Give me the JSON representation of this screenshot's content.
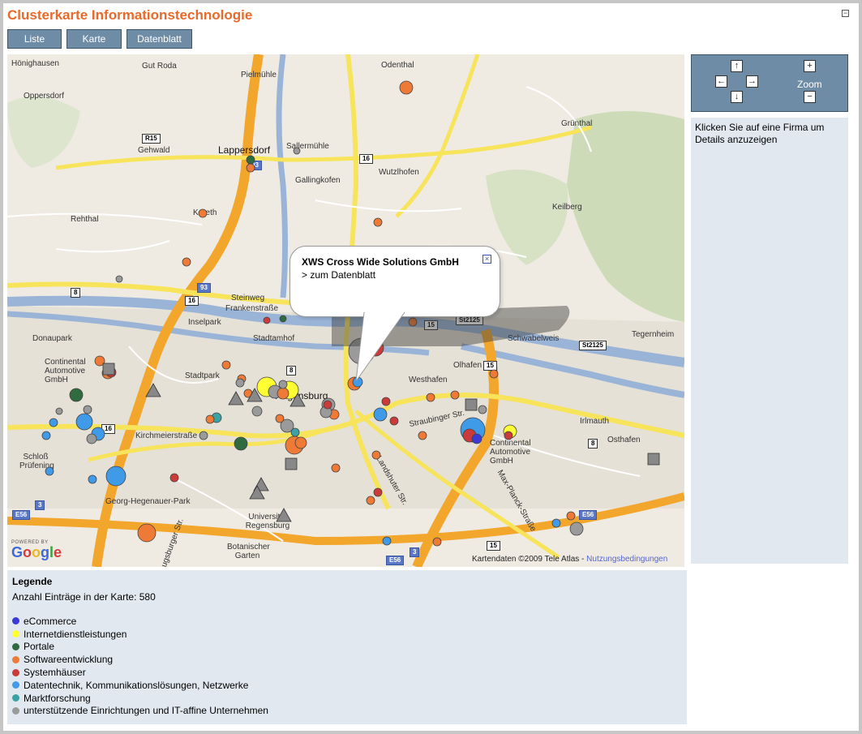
{
  "header": {
    "title": "Clusterkarte Informationstechnologie",
    "collapse_symbol": "−"
  },
  "tabs": [
    {
      "label": "Liste"
    },
    {
      "label": "Karte"
    },
    {
      "label": "Datenblatt"
    }
  ],
  "controls": {
    "up": "↑",
    "down": "↓",
    "left": "←",
    "right": "→",
    "zoom_in": "+",
    "zoom_out": "−",
    "zoom_label": "Zoom"
  },
  "info_panel": {
    "text": "Klicken Sie auf eine Firma um Details anzuzeigen"
  },
  "popup": {
    "company": "XWS Cross Wide Solutions GmbH",
    "link": "> zum Datenblatt",
    "close_symbol": "×"
  },
  "map": {
    "copyright": "Kartendaten ©2009 Tele Atlas -",
    "terms_link": "Nutzungsbedingungen",
    "powered_by": "POWERED BY",
    "logo": "Google",
    "places": [
      {
        "text": "Hönighausen"
      },
      {
        "text": "Gut Roda"
      },
      {
        "text": "Pielmühle"
      },
      {
        "text": "Odenthal"
      },
      {
        "text": "Oppersdorf"
      },
      {
        "text": "Gehwald"
      },
      {
        "text": "Lappersdorf"
      },
      {
        "text": "Sallermühle"
      },
      {
        "text": "Grünthal"
      },
      {
        "text": "Gallingkofen"
      },
      {
        "text": "Wutzlhofen"
      },
      {
        "text": "Rehthal"
      },
      {
        "text": "Kareth"
      },
      {
        "text": "Keilberg"
      },
      {
        "text": "Steinweg"
      },
      {
        "text": "Inselpark"
      },
      {
        "text": "Stadtamhof"
      },
      {
        "text": "Donaupark"
      },
      {
        "text": "Continental Automotive GmbH"
      },
      {
        "text": "Stadtpark"
      },
      {
        "text": "Westhafen"
      },
      {
        "text": "Olhafen"
      },
      {
        "text": "Schwabelweis"
      },
      {
        "text": "Tegernheim"
      },
      {
        "text": "Regensburg"
      },
      {
        "text": "Irlmauth"
      },
      {
        "text": "Osthafen"
      },
      {
        "text": "Continental Automotive GmbH"
      },
      {
        "text": "Schloß Prüfening"
      },
      {
        "text": "Georg-Hegenauer-Park"
      },
      {
        "text": "Universität Regensburg"
      },
      {
        "text": "Botanischer Garten"
      },
      {
        "text": "Kirchmeierstraße"
      },
      {
        "text": "Frankenstraße"
      },
      {
        "text": "Straubinger Str."
      },
      {
        "text": "Landshuter Str."
      },
      {
        "text": "Max-Planck-Straße"
      },
      {
        "text": "Augsburger Str."
      },
      {
        "text": "Ostenthal"
      }
    ],
    "shields": [
      {
        "text": "R15"
      },
      {
        "text": "93"
      },
      {
        "text": "16"
      },
      {
        "text": "8"
      },
      {
        "text": "16"
      },
      {
        "text": "93"
      },
      {
        "text": "15"
      },
      {
        "text": "St2125"
      },
      {
        "text": "St2125"
      },
      {
        "text": "15"
      },
      {
        "text": "8"
      },
      {
        "text": "E56"
      },
      {
        "text": "3"
      },
      {
        "text": "E56"
      },
      {
        "text": "E56"
      },
      {
        "text": "3"
      },
      {
        "text": "16"
      },
      {
        "text": "8"
      },
      {
        "text": "15"
      }
    ]
  },
  "legend": {
    "title": "Legende",
    "count_label": "Anzahl Einträge in der Karte: 580",
    "items": [
      {
        "label": "eCommerce",
        "color": "#3a3ad6"
      },
      {
        "label": "Internetdienstleistungen",
        "color": "#ffff33"
      },
      {
        "label": "Portale",
        "color": "#2f6b3f"
      },
      {
        "label": "Softwareentwicklung",
        "color": "#ef7a35"
      },
      {
        "label": "Systemhäuser",
        "color": "#cc3a3a"
      },
      {
        "label": "Datentechnik, Kommunikationslösungen, Netzwerke",
        "color": "#3f9ae8"
      },
      {
        "label": "Marktforschung",
        "color": "#3aa3a3"
      },
      {
        "label": "unterstützende Einrichtungen und IT-affine Unternehmen",
        "color": "#9a9a9a"
      }
    ]
  }
}
